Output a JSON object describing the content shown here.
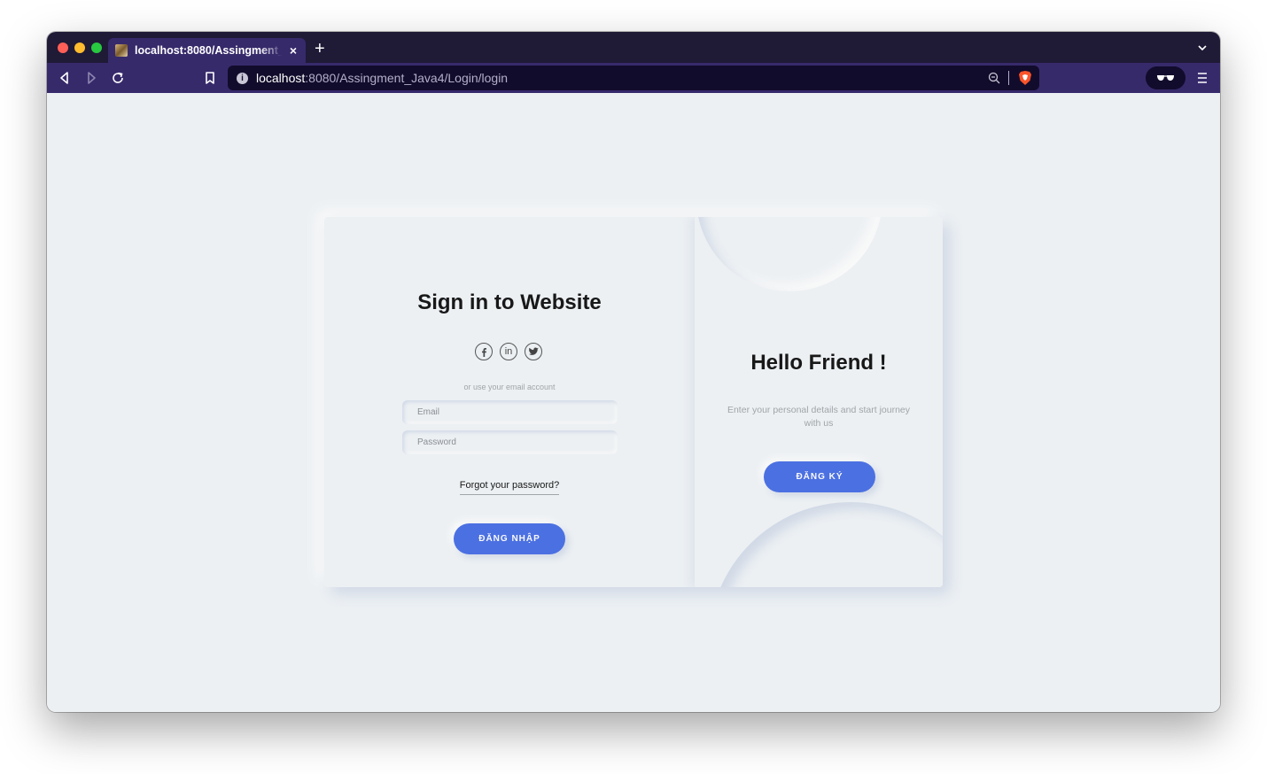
{
  "browser": {
    "tab_title": "localhost:8080/Assingment_Java4/Login/login",
    "url_host": "localhost",
    "url_path": ":8080/Assingment_Java4/Login/login",
    "new_tab": "+",
    "tab_close": "×",
    "site_info": "i"
  },
  "login": {
    "title": "Sign in to Website",
    "socials": [
      {
        "icon": "facebook-icon",
        "glyph": "f"
      },
      {
        "icon": "linkedin-icon",
        "glyph": "in"
      },
      {
        "icon": "twitter-icon",
        "glyph": "t"
      }
    ],
    "or_text": "or use your email account",
    "email_placeholder": "Email",
    "password_placeholder": "Password",
    "forgot": "Forgot your password?",
    "login_button": "ĐĂNG NHẬP"
  },
  "signup": {
    "title": "Hello Friend !",
    "description": "Enter your personal details and start journey with us",
    "signup_button": "ĐĂNG KÝ"
  },
  "colors": {
    "accent": "#4b70e2",
    "background": "#ecf0f3",
    "browser_bar": "#372a6b"
  }
}
